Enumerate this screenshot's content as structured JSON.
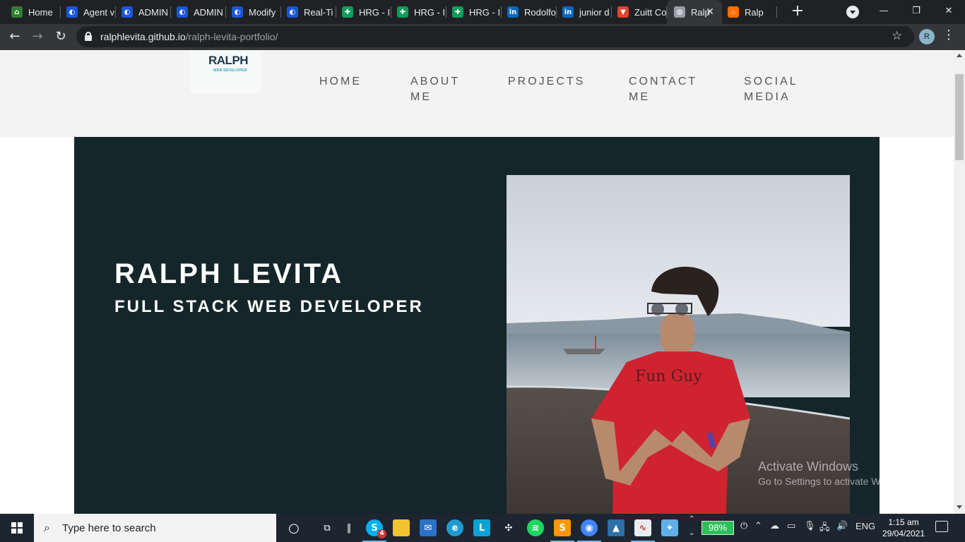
{
  "browser": {
    "tabs": [
      {
        "title": "Home",
        "favicon": "home-favicon",
        "color": "#2e7d32"
      },
      {
        "title": "Agent v",
        "favicon": "shield-favicon",
        "color": "#1a56db"
      },
      {
        "title": "ADMIN",
        "favicon": "shield-favicon",
        "color": "#1a56db"
      },
      {
        "title": "ADMIN",
        "favicon": "shield-favicon",
        "color": "#1a56db"
      },
      {
        "title": "Modify",
        "favicon": "shield-favicon",
        "color": "#1a56db"
      },
      {
        "title": "Real-Ti",
        "favicon": "shield-favicon",
        "color": "#1a56db"
      },
      {
        "title": "HRG - I",
        "favicon": "sheets-favicon",
        "color": "#0f9d58"
      },
      {
        "title": "HRG - I",
        "favicon": "sheets-favicon",
        "color": "#0f9d58"
      },
      {
        "title": "HRG - I",
        "favicon": "sheets-favicon",
        "color": "#0f9d58"
      },
      {
        "title": "Rodolfo",
        "favicon": "linkedin-favicon",
        "color": "#0a66c2"
      },
      {
        "title": "junior d",
        "favicon": "linkedin-favicon",
        "color": "#0a66c2"
      },
      {
        "title": "Zuitt Co",
        "favicon": "gitlab-favicon",
        "color": "#e24329"
      },
      {
        "title": "Ralp",
        "favicon": "globe-favicon",
        "color": "#9aa0a6",
        "active": true
      },
      {
        "title": "Ralp",
        "favicon": "fire-favicon",
        "color": "#ff6d00"
      }
    ],
    "url_host": "ralphlevita.github.io",
    "url_path": "/ralph-levita-portfolio/",
    "profile_initial": "R"
  },
  "site": {
    "logo_text": "RALPH",
    "logo_subtext": "WEB DEVELOPER",
    "nav": [
      {
        "line1": "HOME",
        "line2": ""
      },
      {
        "line1": "ABOUT",
        "line2": "ME"
      },
      {
        "line1": "PROJECTS",
        "line2": ""
      },
      {
        "line1": "CONTACT",
        "line2": "ME"
      },
      {
        "line1": "SOCIAL",
        "line2": "MEDIA"
      }
    ],
    "hero_name": "RALPH LEVITA",
    "hero_role": "FULL STACK WEB DEVELOPER",
    "hero_bg": "#14262a",
    "shirt_text": "Fun Guy"
  },
  "watermark": {
    "line1": "Activate Windows",
    "line2": "Go to Settings to activate Windows."
  },
  "taskbar": {
    "search_placeholder": "Type here to search",
    "skype_badge": "4",
    "battery": "98%",
    "language": "ENG",
    "time": "1:15 am",
    "date": "29/04/2021"
  }
}
